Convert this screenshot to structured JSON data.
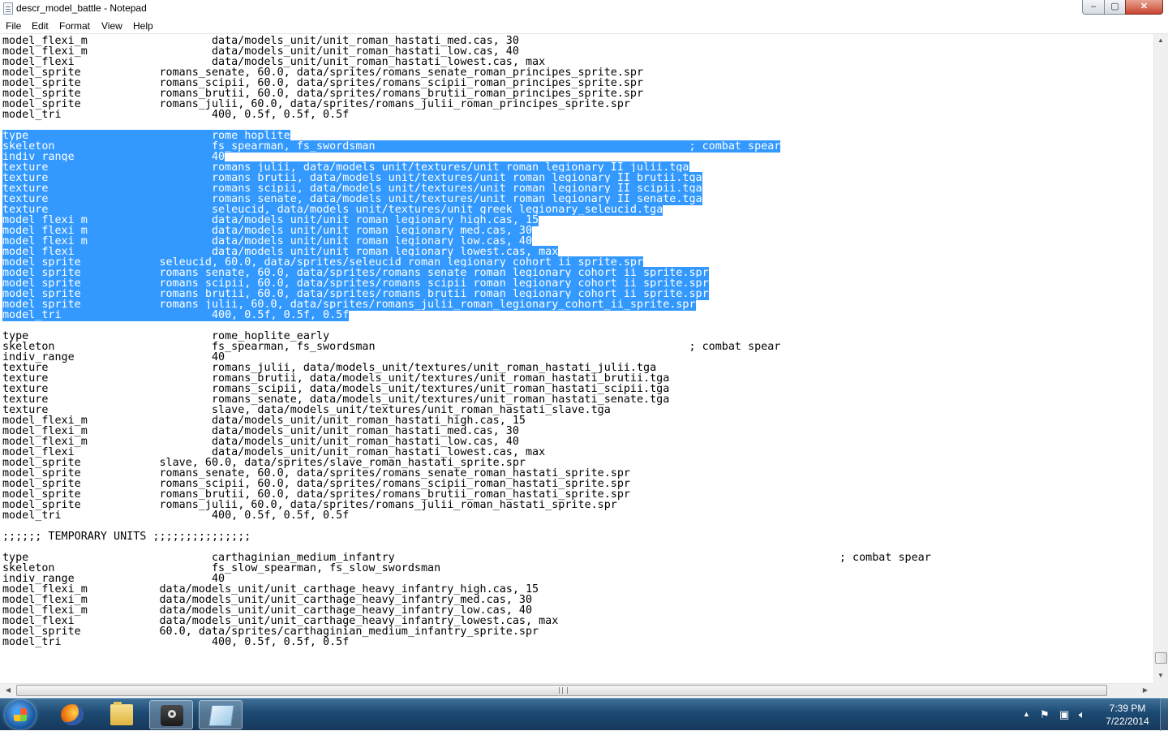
{
  "window": {
    "title": "descr_model_battle - Notepad",
    "buttons": {
      "minimize": "‒",
      "maximize": "▢",
      "close": "✕"
    }
  },
  "menu": [
    "File",
    "Edit",
    "Format",
    "View",
    "Help"
  ],
  "lines": [
    {
      "text": "model_flexi_m                   data/models_unit/unit_roman_hastati_med.cas, 30",
      "sel": ""
    },
    {
      "text": "model_flexi_m                   data/models_unit/unit_roman_hastati_low.cas, 40",
      "sel": ""
    },
    {
      "text": "model_flexi                     data/models_unit/unit_roman_hastati_lowest.cas, max",
      "sel": ""
    },
    {
      "text": "model_sprite            romans_senate, 60.0, data/sprites/romans_senate_roman_principes_sprite.spr",
      "sel": ""
    },
    {
      "text": "model_sprite            romans_scipii, 60.0, data/sprites/romans_scipii_roman_principes_sprite.spr",
      "sel": ""
    },
    {
      "text": "model_sprite            romans_brutii, 60.0, data/sprites/romans_brutii_roman_principes_sprite.spr",
      "sel": ""
    },
    {
      "text": "model_sprite            romans_julii, 60.0, data/sprites/romans_julii_roman_principes_sprite.spr",
      "sel": ""
    },
    {
      "text": "model_tri                       400, 0.5f, 0.5f, 0.5f",
      "sel": ""
    },
    {
      "text": "",
      "sel": ""
    },
    {
      "text": "",
      "sel": "type                            rome_hoplite"
    },
    {
      "text": "",
      "sel": "skeleton                        fs_spearman, fs_swordsman                                                ; combat spear"
    },
    {
      "text": "",
      "sel": "indiv_range                     40"
    },
    {
      "text": "",
      "sel": "texture                         romans_julii, data/models_unit/textures/unit_roman_legionary_II_julii.tga"
    },
    {
      "text": "",
      "sel": "texture                         romans_brutii, data/models_unit/textures/unit_roman_legionary_II_brutii.tga"
    },
    {
      "text": "",
      "sel": "texture                         romans_scipii, data/models_unit/textures/unit_roman_legionary_II_scipii.tga"
    },
    {
      "text": "",
      "sel": "texture                         romans_senate, data/models_unit/textures/unit_roman_legionary_II_senate.tga"
    },
    {
      "text": "",
      "sel": "texture                         seleucid, data/models_unit/textures/unit_greek_legionary_seleucid.tga"
    },
    {
      "text": "",
      "sel": "model_flexi_m                   data/models_unit/unit_roman_legionary_high.cas, 15"
    },
    {
      "text": "",
      "sel": "model_flexi_m                   data/models_unit/unit_roman_legionary_med.cas, 30"
    },
    {
      "text": "",
      "sel": "model_flexi_m                   data/models_unit/unit_roman_legionary_low.cas, 40"
    },
    {
      "text": "",
      "sel": "model_flexi                     data/models_unit/unit_roman_legionary_lowest.cas, max"
    },
    {
      "text": "",
      "sel": "model_sprite            seleucid, 60.0, data/sprites/seleucid_roman_legionary_cohort_ii_sprite.spr"
    },
    {
      "text": "",
      "sel": "model_sprite            romans_senate, 60.0, data/sprites/romans_senate_roman_legionary_cohort_ii_sprite.spr"
    },
    {
      "text": "",
      "sel": "model_sprite            romans_scipii, 60.0, data/sprites/romans_scipii_roman_legionary_cohort_ii_sprite.spr"
    },
    {
      "text": "",
      "sel": "model_sprite            romans_brutii, 60.0, data/sprites/romans_brutii_roman_legionary_cohort_ii_sprite.spr"
    },
    {
      "text": "",
      "sel": "model_sprite            romans_julii, 60.0, data/sprites/romans_julii_roman_legionary_cohort_ii_sprite.spr"
    },
    {
      "text": "",
      "sel": "model_tri                       400, 0.5f, 0.5f, 0.5f"
    },
    {
      "text": "",
      "sel": ""
    },
    {
      "text": "type                            rome_hoplite_early",
      "sel": ""
    },
    {
      "text": "skeleton                        fs_spearman, fs_swordsman                                                ; combat spear",
      "sel": ""
    },
    {
      "text": "indiv_range                     40",
      "sel": ""
    },
    {
      "text": "texture                         romans_julii, data/models_unit/textures/unit_roman_hastati_julii.tga",
      "sel": ""
    },
    {
      "text": "texture                         romans_brutii, data/models_unit/textures/unit_roman_hastati_brutii.tga",
      "sel": ""
    },
    {
      "text": "texture                         romans_scipii, data/models_unit/textures/unit_roman_hastati_scipii.tga",
      "sel": ""
    },
    {
      "text": "texture                         romans_senate, data/models_unit/textures/unit_roman_hastati_senate.tga",
      "sel": ""
    },
    {
      "text": "texture                         slave, data/models_unit/textures/unit_roman_hastati_slave.tga",
      "sel": ""
    },
    {
      "text": "model_flexi_m                   data/models_unit/unit_roman_hastati_high.cas, 15",
      "sel": ""
    },
    {
      "text": "model_flexi_m                   data/models_unit/unit_roman_hastati_med.cas, 30",
      "sel": ""
    },
    {
      "text": "model_flexi_m                   data/models_unit/unit_roman_hastati_low.cas, 40",
      "sel": ""
    },
    {
      "text": "model_flexi                     data/models_unit/unit_roman_hastati_lowest.cas, max",
      "sel": ""
    },
    {
      "text": "model_sprite            slave, 60.0, data/sprites/slave_roman_hastati_sprite.spr",
      "sel": ""
    },
    {
      "text": "model_sprite            romans_senate, 60.0, data/sprites/romans_senate_roman_hastati_sprite.spr",
      "sel": ""
    },
    {
      "text": "model_sprite            romans_scipii, 60.0, data/sprites/romans_scipii_roman_hastati_sprite.spr",
      "sel": ""
    },
    {
      "text": "model_sprite            romans_brutii, 60.0, data/sprites/romans_brutii_roman_hastati_sprite.spr",
      "sel": ""
    },
    {
      "text": "model_sprite            romans_julii, 60.0, data/sprites/romans_julii_roman_hastati_sprite.spr",
      "sel": ""
    },
    {
      "text": "model_tri                       400, 0.5f, 0.5f, 0.5f",
      "sel": ""
    },
    {
      "text": "",
      "sel": ""
    },
    {
      "text": ";;;;;; TEMPORARY UNITS ;;;;;;;;;;;;;;;",
      "sel": ""
    },
    {
      "text": "",
      "sel": ""
    },
    {
      "text": "type                            carthaginian_medium_infantry                                                                    ; combat spear",
      "sel": ""
    },
    {
      "text": "skeleton                        fs_slow_spearman, fs_slow_swordsman",
      "sel": ""
    },
    {
      "text": "indiv_range                     40",
      "sel": ""
    },
    {
      "text": "model_flexi_m           data/models_unit/unit_carthage_heavy_infantry_high.cas, 15",
      "sel": ""
    },
    {
      "text": "model_flexi_m           data/models_unit/unit_carthage_heavy_infantry_med.cas, 30",
      "sel": ""
    },
    {
      "text": "model_flexi_m           data/models_unit/unit_carthage_heavy_infantry_low.cas, 40",
      "sel": ""
    },
    {
      "text": "model_flexi             data/models_unit/unit_carthage_heavy_infantry_lowest.cas, max",
      "sel": ""
    },
    {
      "text": "model_sprite            60.0, data/sprites/carthaginian_medium_infantry_sprite.spr",
      "sel": ""
    },
    {
      "text": "model_tri                       400, 0.5f, 0.5f, 0.5f",
      "sel": ""
    }
  ],
  "taskbar": {
    "apps": [
      "firefox-icon",
      "windows-explorer-icon",
      "steam-icon",
      "notepad-icon"
    ],
    "clock": {
      "time": "7:39 PM",
      "date": "7/22/2014"
    }
  },
  "colors": {
    "selection": "#3399ff",
    "taskbar": "#1c4a73"
  }
}
